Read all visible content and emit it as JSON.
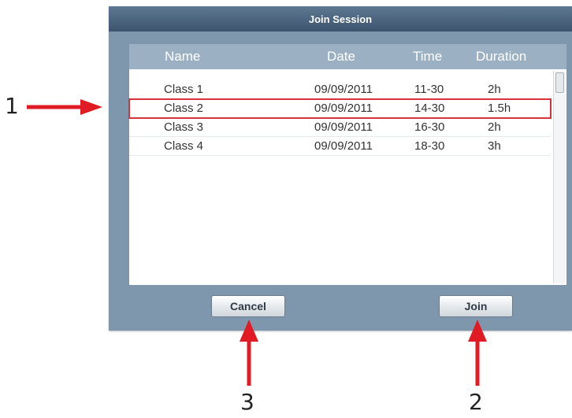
{
  "dialog": {
    "title": "Join Session",
    "columns": {
      "name": "Name",
      "date": "Date",
      "time": "Time",
      "duration": "Duration"
    },
    "rows": [
      {
        "name": "Class 1",
        "date": "09/09/2011",
        "time": "11-30",
        "duration": "2h"
      },
      {
        "name": "Class 2",
        "date": "09/09/2011",
        "time": "14-30",
        "duration": "1.5h"
      },
      {
        "name": "Class 3",
        "date": "09/09/2011",
        "time": "16-30",
        "duration": "2h"
      },
      {
        "name": "Class 4",
        "date": "09/09/2011",
        "time": "18-30",
        "duration": "3h"
      }
    ],
    "selected_row": "Class 2",
    "buttons": {
      "cancel": "Cancel",
      "join": "Join"
    }
  },
  "annotations": {
    "one": "1",
    "two": "2",
    "three": "3"
  },
  "colors": {
    "arrow": "#e01b24",
    "highlight": "#d8323c",
    "dialog_bg": "#7f97ad",
    "titlebar": "#3c546d"
  }
}
